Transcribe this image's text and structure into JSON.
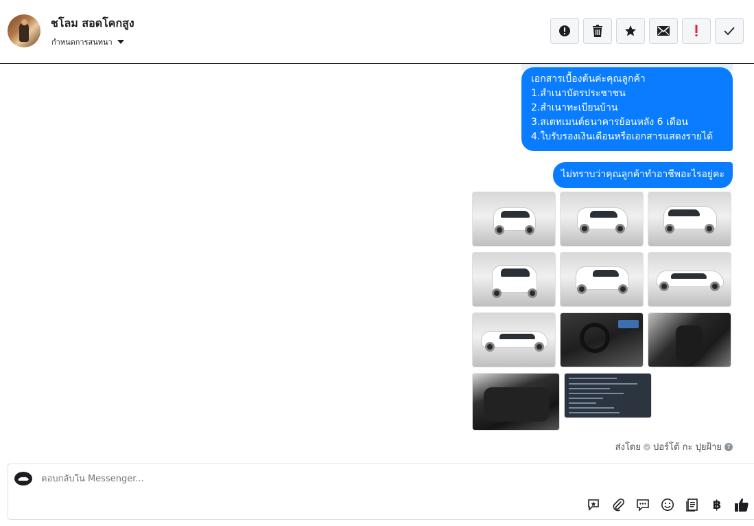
{
  "header": {
    "contact_name": "ชโลม สอดโคกสูง",
    "convo_settings_label": "กำหนดการสนทนา",
    "toolbar": [
      {
        "name": "spam-button",
        "icon": "alert-circle-icon"
      },
      {
        "name": "delete-button",
        "icon": "trash-icon"
      },
      {
        "name": "star-button",
        "icon": "star-icon"
      },
      {
        "name": "mark-unread-button",
        "icon": "envelope-icon"
      },
      {
        "name": "follow-up-button",
        "icon": "exclamation-icon"
      },
      {
        "name": "mark-done-button",
        "icon": "check-icon"
      }
    ]
  },
  "messages": {
    "docs_bubble": [
      "เอกสารเบื้องต้นค่ะคุณลูกค้า",
      "1.สำเนาบัตรประชาชน",
      "2.สำเนาทะเบียนบ้าน",
      "3.สเตทเมนต์ธนาคารย้อนหลัง 6 เดือน",
      "4.ใบรับรองเงินเดือนหรือเอกสารแสดงรายได้"
    ],
    "question_bubble": "ไม่ทราบว่าคุณลูกค้าทำอาชีพอะไรอยู่คะ",
    "photo_count": 11,
    "sent_by_prefix": "ส่งโดย",
    "sent_by_name": "ปอร์โต้ กะ ปุยฝ้าย"
  },
  "composer": {
    "placeholder": "ตอบกลับใน Messenger...",
    "tools": [
      "sticker-icon",
      "attachment-icon",
      "saved-reply-icon",
      "emoji-icon",
      "template-icon",
      "baht-icon",
      "thumbs-up-icon"
    ],
    "baht_symbol": "฿"
  },
  "colors": {
    "bubble_blue": "#0a7cff",
    "header_border": "#1c1e21"
  }
}
